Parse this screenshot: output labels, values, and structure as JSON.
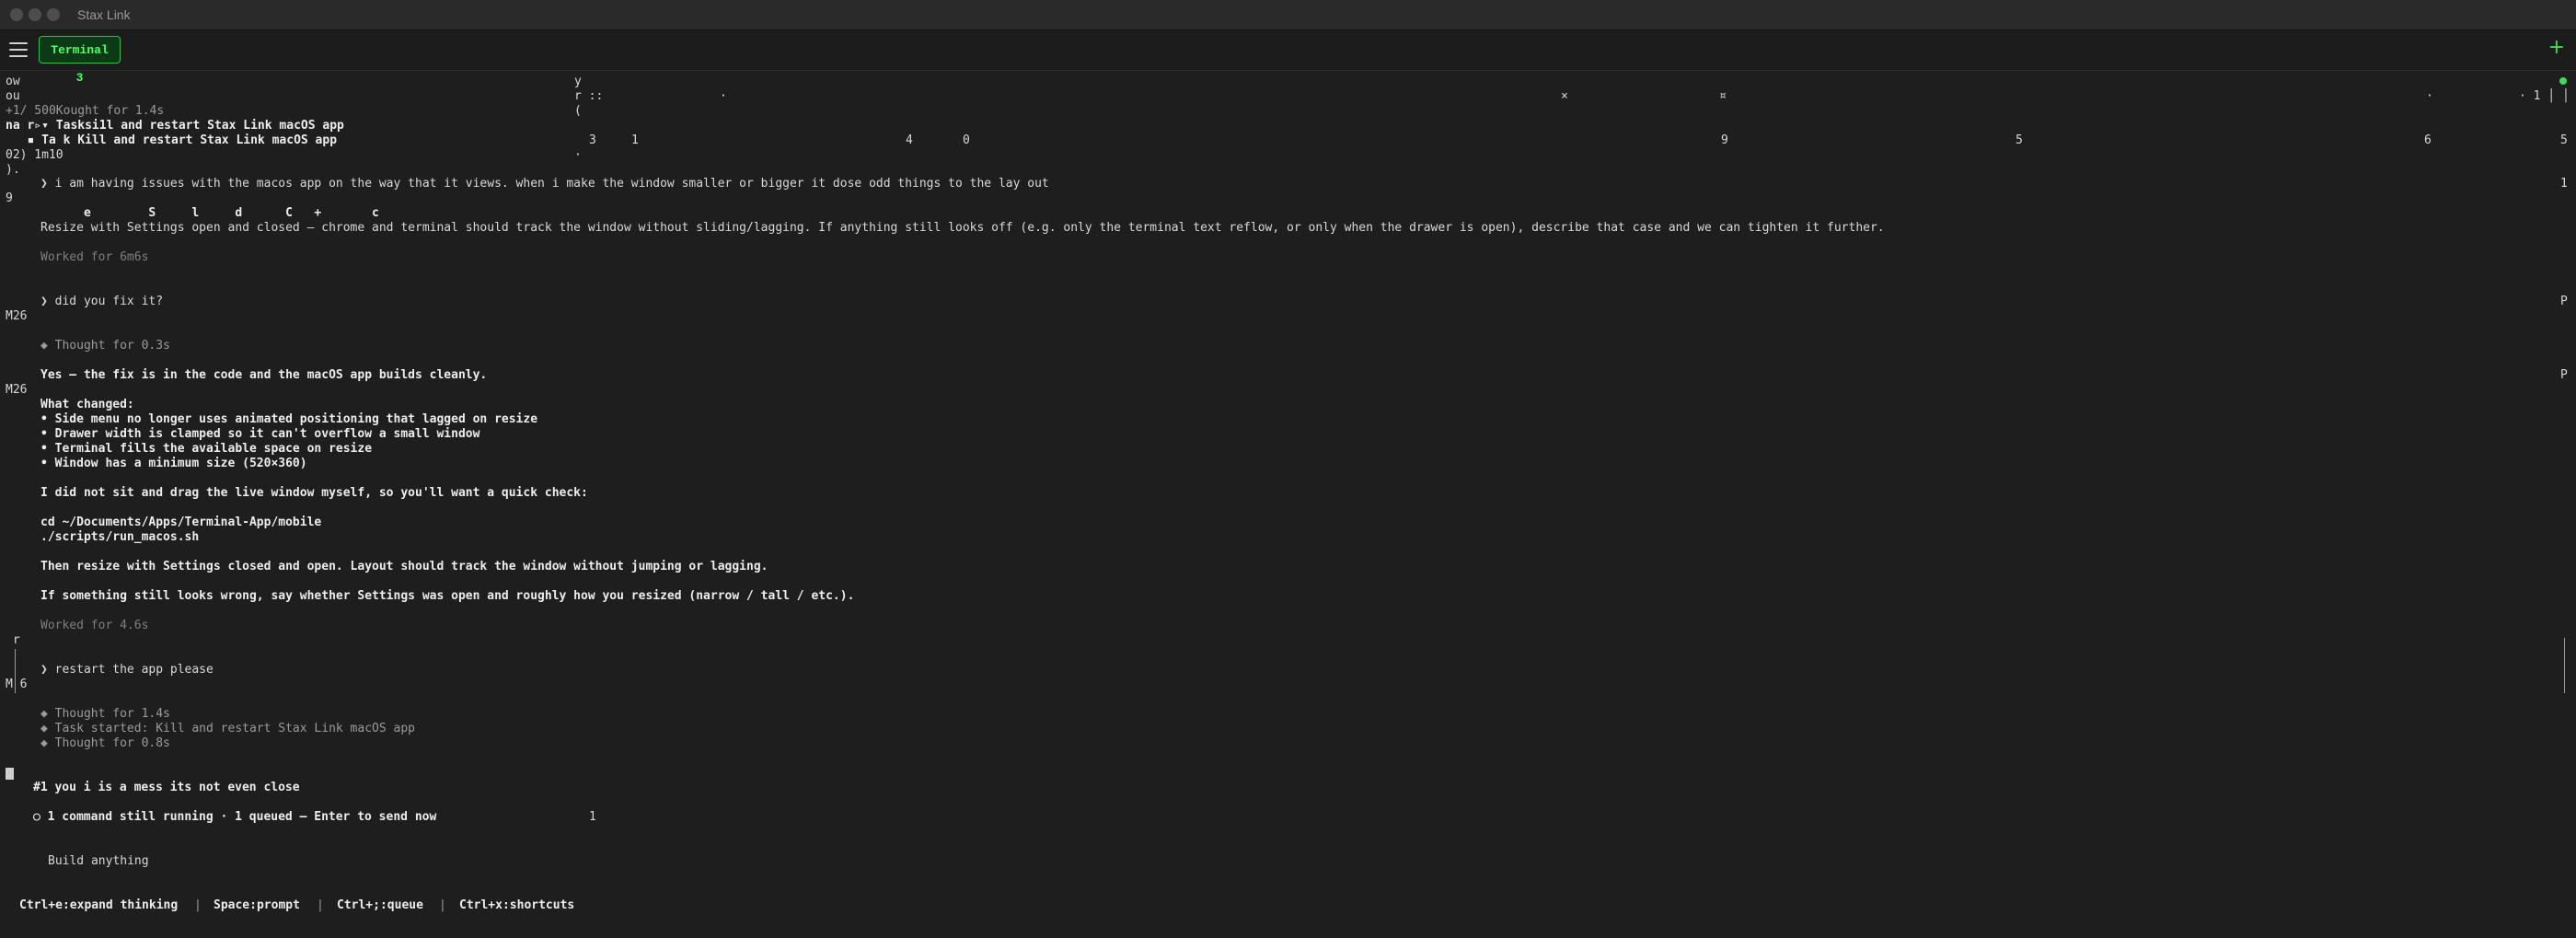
{
  "window": {
    "title": "Stax Link"
  },
  "toolbar": {
    "tab_label": "Terminal 3",
    "add_label": "+"
  },
  "artifacts": {
    "l1a": "ow",
    "l1b": "y",
    "l2a": "ou",
    "l2b": "r ::",
    "l2c": "·",
    "l2d": "×",
    "l2e": "¤",
    "l2f": "·",
    "l2g": "· 1 │ │",
    "l3b": "(",
    "l5a": " l",
    "l5n1": "3",
    "l5n2": "1",
    "l5n3": "4",
    "l5n4": "0",
    "l5n5": "9",
    "l5n6": "5",
    "l5n7": "6",
    "l5n8": "5",
    "l6a": "02) 1m10",
    "l6b": "·",
    "l7a": ").",
    "l8r": "1",
    "l9a": "9",
    "l10": "      e        S     l     d      C   +       c",
    "m26a": "M26",
    "pa": "P",
    "m26b": "M26",
    "pb": "P",
    "left_r": " r",
    "left_m6": "M 6",
    "queue_num": "1"
  },
  "terminal": {
    "thought_1": "+1/ 500Kought for 1.4s",
    "tasks_header": "na r▹▾ Tasksi1l and restart Stax Link macOS app",
    "task_line": "   ▪ Ta k Kill and restart Stax Link macOS app",
    "prompt_1": "❯ i am having issues with the macos app on the way that it views. when i make the window smaller or bigger it dose odd things to the lay out",
    "resize_line": "Resize with Settings open and closed — chrome and terminal should track the window without sliding/lagging. If anything still looks off (e.g. only the terminal text reflow, or only when the drawer is open), describe that case and we can tighten it further.",
    "worked_1": "Worked for 6m6s",
    "prompt_2": "❯ did you fix it?",
    "thought_2": "◆ Thought for 0.3s",
    "yes_line": "Yes — the fix is in the code and the macOS app builds cleanly.",
    "what_changed": "What changed:",
    "bullets": [
      "• Side menu no longer uses animated positioning that lagged on resize",
      "• Drawer width is clamped so it can't overflow a small window",
      "• Terminal fills the available space on resize",
      "• Window has a minimum size (520×360)"
    ],
    "check_line": "I did not sit and drag the live window myself, so you'll want a quick check:",
    "cmd_1": "cd ~/Documents/Apps/Terminal-App/mobile",
    "cmd_2": "./scripts/run_macos.sh",
    "then_line": "Then resize with Settings closed and open. Layout should track the window without jumping or lagging.",
    "if_line": "If something still looks wrong, say whether Settings was open and roughly how you resized (narrow / tall / etc.).",
    "worked_2": "Worked for 4.6s",
    "prompt_3": "❯ restart the app please",
    "thought_3": "◆ Thought for 1.4s",
    "task_started": "◆ Task started: Kill and restart Stax Link macOS app",
    "thought_4": "◆ Thought for 0.8s",
    "queued_msg": "#1 you i is a mess its not even close",
    "status_line": "○ 1 command still running · 1 queued — Enter to send now",
    "input_placeholder": "Build anything"
  },
  "footer": {
    "shortcuts": [
      "Ctrl+e:expand thinking",
      "Space:prompt",
      "Ctrl+;:queue",
      "Ctrl+x:shortcuts"
    ],
    "separator": "|"
  },
  "colors": {
    "accent_green": "#3ddc5a",
    "tab_bg": "#0d3a16",
    "background": "#1e1e1e"
  }
}
